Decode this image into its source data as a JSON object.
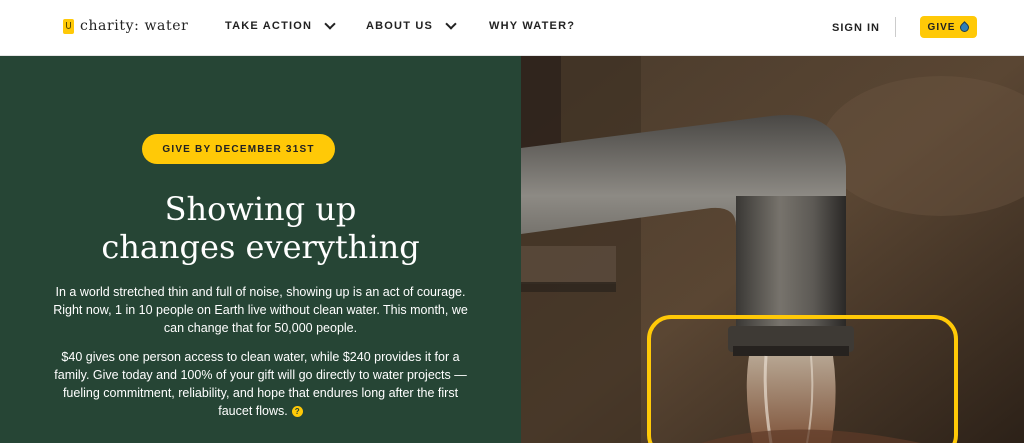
{
  "brand": {
    "name": "charity: water"
  },
  "nav": {
    "items": [
      {
        "label": "TAKE ACTION",
        "has_dropdown": true
      },
      {
        "label": "ABOUT US",
        "has_dropdown": true
      },
      {
        "label": "WHY WATER?",
        "has_dropdown": false
      }
    ],
    "sign_in": "SIGN IN",
    "give": "GIVE"
  },
  "hero": {
    "badge": "GIVE BY DECEMBER 31ST",
    "title_line1": "Showing up",
    "title_line2": "changes everything",
    "paragraph1": "In a world stretched thin and full of noise, showing up is an act of courage. Right now, 1 in 10 people on Earth live without clean water. This month, we can change that for 50,000 people.",
    "paragraph2": "$40 gives one person access to clean water, while $240 provides it for a family. Give today and 100% of your gift will go directly to water projects — fueling commitment, reliability, and hope that endures long after the first faucet flows.",
    "info_glyph": "?"
  },
  "colors": {
    "accent": "#ffc907",
    "hero_bg": "#264535"
  },
  "icons": [
    "jerrycan-logo-icon",
    "chevron-down-icon",
    "water-drop-icon",
    "question-icon"
  ]
}
